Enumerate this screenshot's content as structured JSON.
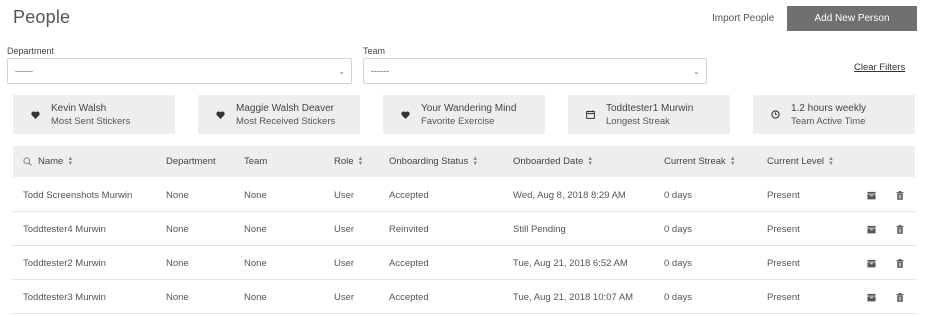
{
  "header": {
    "title": "People",
    "import_label": "Import People",
    "add_label": "Add New Person"
  },
  "filters": {
    "department_label": "Department",
    "department_value": "------",
    "team_label": "Team",
    "team_value": "------",
    "clear_label": "Clear Filters"
  },
  "stats": [
    {
      "icon": "heart-icon",
      "title": "Kevin Walsh",
      "subtitle": "Most Sent Stickers"
    },
    {
      "icon": "heart-icon",
      "title": "Maggie Walsh Deaver",
      "subtitle": "Most Received Stickers"
    },
    {
      "icon": "heart-icon",
      "title": "Your Wandering Mind",
      "subtitle": "Favorite Exercise"
    },
    {
      "icon": "calendar-icon",
      "title": "Toddtester1 Murwin",
      "subtitle": "Longest Streak"
    },
    {
      "icon": "clock-icon",
      "title": "1.2 hours weekly",
      "subtitle": "Team Active Time"
    }
  ],
  "table": {
    "columns": [
      {
        "label": "Name",
        "sortable": true
      },
      {
        "label": "Department",
        "sortable": false
      },
      {
        "label": "Team",
        "sortable": false
      },
      {
        "label": "Role",
        "sortable": true
      },
      {
        "label": "Onboarding Status",
        "sortable": true
      },
      {
        "label": "Onboarded Date",
        "sortable": true
      },
      {
        "label": "Current Streak",
        "sortable": true
      },
      {
        "label": "Current Level",
        "sortable": true
      }
    ],
    "rows": [
      [
        "Todd Screenshots Murwin",
        "None",
        "None",
        "User",
        "Accepted",
        "Wed, Aug 8, 2018 8:29 AM",
        "0 days",
        "Present"
      ],
      [
        "Toddtester4 Murwin",
        "None",
        "None",
        "User",
        "Reinvited",
        "Still Pending",
        "0 days",
        "Present"
      ],
      [
        "Toddtester2 Murwin",
        "None",
        "None",
        "User",
        "Accepted",
        "Tue, Aug 21, 2018 6:52 AM",
        "0 days",
        "Present"
      ],
      [
        "Toddtester3 Murwin",
        "None",
        "None",
        "User",
        "Accepted",
        "Tue, Aug 21, 2018 10:07 AM",
        "0 days",
        "Present"
      ]
    ],
    "row_actions": [
      "archive-icon",
      "trash-icon"
    ]
  }
}
